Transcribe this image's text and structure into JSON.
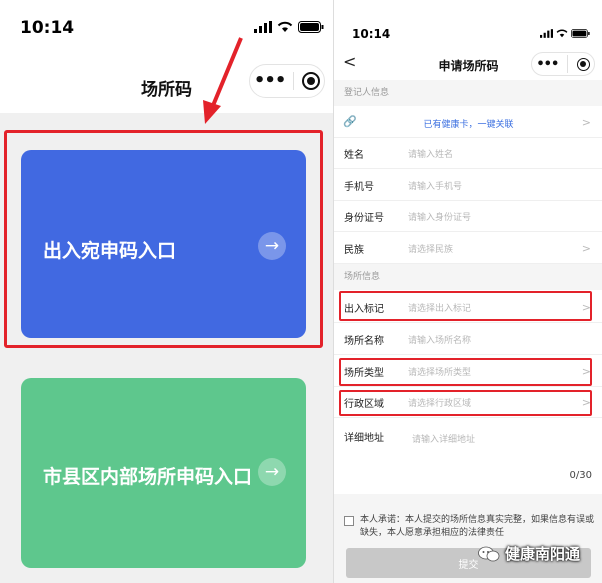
{
  "left_screen": {
    "status_time": "10:14",
    "page_title": "场所码",
    "cards": [
      {
        "label": "出入宛申码入口",
        "arrow": "→",
        "color": "#4169e1"
      },
      {
        "label": "市县区内部场所申码入口",
        "arrow": "→",
        "color": "#5ec78d"
      }
    ]
  },
  "right_screen": {
    "status_time": "10:14",
    "back_glyph": "<",
    "page_title": "申请场所码",
    "section_registrant": "登记人信息",
    "link_row": {
      "icon": "link-icon",
      "text": "已有健康卡，一键关联",
      "chevron": ">"
    },
    "fields_registrant": [
      {
        "label": "姓名",
        "placeholder": "请输入姓名",
        "chevron": ""
      },
      {
        "label": "手机号",
        "placeholder": "请输入手机号",
        "chevron": ""
      },
      {
        "label": "身份证号",
        "placeholder": "请输入身份证号",
        "chevron": ""
      },
      {
        "label": "民族",
        "placeholder": "请选择民族",
        "chevron": ">"
      }
    ],
    "section_place": "场所信息",
    "fields_place": [
      {
        "label": "出入标记",
        "placeholder": "请选择出入标记",
        "chevron": ">"
      },
      {
        "label": "场所名称",
        "placeholder": "请输入场所名称",
        "chevron": ""
      },
      {
        "label": "场所类型",
        "placeholder": "请选择场所类型",
        "chevron": ">"
      },
      {
        "label": "行政区域",
        "placeholder": "请选择行政区域",
        "chevron": ">"
      }
    ],
    "address": {
      "label": "详细地址",
      "placeholder": "请输入详细地址",
      "counter": "0/30"
    },
    "promise_text": "本人承诺：本人提交的场所信息真实完整，如果信息有误或缺失，本人愿意承担相应的法律责任",
    "submit_label": "提交"
  },
  "watermark": {
    "text": "健康南阳通"
  },
  "colors": {
    "highlight": "#e3222a",
    "accent": "#3b6fe0"
  }
}
